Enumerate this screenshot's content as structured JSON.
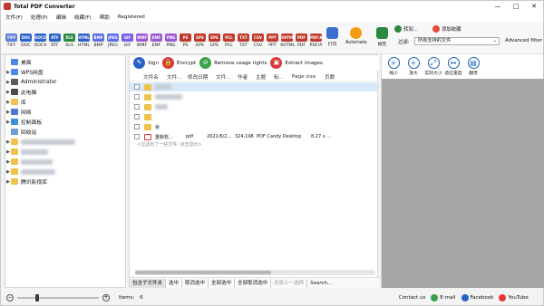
{
  "window": {
    "title": "Total PDF Converter"
  },
  "menu": [
    "文件(F)",
    "处理(P)",
    "编辑",
    "收藏(F)",
    "帮助",
    "Registered"
  ],
  "formats": [
    {
      "label": "TIFF",
      "color": "#5f7fd6"
    },
    {
      "label": "DOC",
      "color": "#2b62c7"
    },
    {
      "label": "DOCX",
      "color": "#2b62c7"
    },
    {
      "label": "RTF",
      "color": "#2b62c7"
    },
    {
      "label": "XLS",
      "color": "#2b8a3e"
    },
    {
      "label": "HTML",
      "color": "#2b62c7"
    },
    {
      "label": "BMP",
      "color": "#5e6ee8"
    },
    {
      "label": "JPEG",
      "color": "#5e6ee8"
    },
    {
      "label": "GIF",
      "color": "#7a5ee8"
    },
    {
      "label": "WMF",
      "color": "#9b59d6"
    },
    {
      "label": "EMF",
      "color": "#9b59d6"
    },
    {
      "label": "PNG",
      "color": "#9b59d6"
    },
    {
      "label": "PS",
      "color": "#c0392b"
    },
    {
      "label": "EPS",
      "color": "#c0392b"
    },
    {
      "label": "EPS",
      "color": "#c0392b"
    },
    {
      "label": "PCL",
      "color": "#c0392b"
    },
    {
      "label": "TXT",
      "color": "#c0392b"
    },
    {
      "label": "CSV",
      "color": "#c0392b"
    },
    {
      "label": "PPT",
      "color": "#c0392b"
    },
    {
      "label": "XHTML",
      "color": "#c0392b"
    },
    {
      "label": "PDF",
      "color": "#c0392b"
    },
    {
      "label": "PDF/A",
      "color": "#c0392b"
    }
  ],
  "toolbar": {
    "print": "打印",
    "automate": "Automate",
    "report": "报告"
  },
  "side": {
    "convert": "转到...",
    "add_fav": "添加收藏",
    "filter_label": "过滤:",
    "filter_value": "所有支持的文件",
    "advanced_filter": "Advanced filter"
  },
  "tree": [
    {
      "label": "桌面",
      "color": "#4f87e4",
      "expander": ""
    },
    {
      "label": "WPS网盘",
      "color": "#4f87e4",
      "expander": "▶"
    },
    {
      "label": "Administrator",
      "color": "#5b5b5b",
      "expander": "▶"
    },
    {
      "label": "此电脑",
      "color": "#4a4a4a",
      "expander": "▶"
    },
    {
      "label": "库",
      "color": "#f0c24b",
      "expander": "▶"
    },
    {
      "label": "网络",
      "color": "#4a7bd0",
      "expander": "▶"
    },
    {
      "label": "控制面板",
      "color": "#3a8fd6",
      "expander": "▶"
    },
    {
      "label": "回收站",
      "color": "#6aa0d6",
      "expander": ""
    },
    {
      "label": "",
      "color": "#f0c24b",
      "expander": "▶"
    },
    {
      "label": "",
      "color": "#f0c24b",
      "expander": "▶"
    },
    {
      "label": "",
      "color": "#f0c24b",
      "expander": "▶"
    },
    {
      "label": "",
      "color": "#f0c24b",
      "expander": "▶"
    },
    {
      "label": "腾讯影视库",
      "color": "#f0c24b",
      "expander": "▶"
    }
  ],
  "actions": [
    {
      "label": "Sign",
      "color": "#2b62c7",
      "icon": "✎"
    },
    {
      "label": "Encrypt",
      "color": "#d93a3a",
      "icon": "🔒"
    },
    {
      "label": "Remove usage rights",
      "color": "#3aa24a",
      "icon": "⊘"
    },
    {
      "label": "Extract images",
      "color": "#d93a3a",
      "icon": "▣"
    }
  ],
  "columns": [
    "文件名",
    "文件...",
    "修改日期",
    "文件...",
    "作者",
    "主题",
    "标...",
    "Page size",
    "页数"
  ],
  "rows": [
    {
      "name": "",
      "type": "",
      "date": "",
      "size": "",
      "author": "",
      "pagesize": ""
    },
    {
      "name": "",
      "type": "",
      "date": "",
      "size": "",
      "author": "",
      "pagesize": ""
    },
    {
      "name": "",
      "type": "",
      "date": "",
      "size": "",
      "author": "",
      "pagesize": ""
    },
    {
      "name": "",
      "type": "",
      "date": "",
      "size": "",
      "author": "",
      "pagesize": ""
    },
    {
      "name": "余",
      "type": "",
      "date": "",
      "size": "",
      "author": "",
      "pagesize": ""
    },
    {
      "name": "重新软...",
      "type": "pdf",
      "date": "2021/6/2...",
      "size": "324,198",
      "author": "PDF Candy Desktop",
      "pagesize": "8.27 x ..."
    }
  ],
  "hint": "<过滤出了一些文件: 点击显示>",
  "bottom": [
    "包含子文件夹",
    "选中",
    "取消选中",
    "全部选中",
    "全部取消选中",
    "还原上一选择",
    "Search..."
  ],
  "right_tools": [
    {
      "label": "缩小",
      "icon": "+"
    },
    {
      "label": "放大",
      "icon": "+"
    },
    {
      "label": "实际大小",
      "icon": "⤢"
    },
    {
      "label": "适应宽度",
      "icon": "↔"
    },
    {
      "label": "翻页",
      "icon": "▤"
    }
  ],
  "status": {
    "items_label": "Items:",
    "items_count": "6",
    "contact": "Contact us",
    "email": "E-mail",
    "facebook": "Facebook",
    "youtube": "YouTube"
  }
}
